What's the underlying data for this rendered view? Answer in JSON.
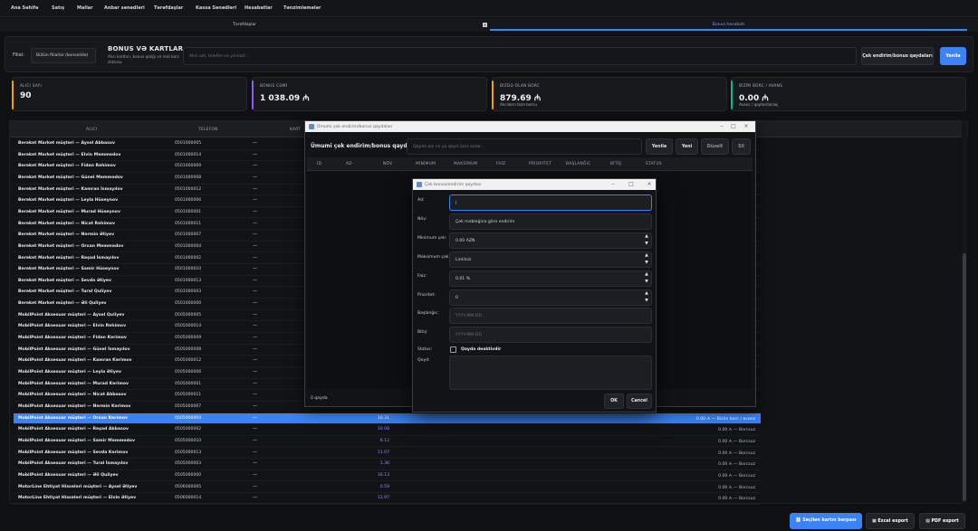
{
  "menu": [
    "Ana Səhifə",
    "Satış",
    "Mallar",
    "Anbar sənədləri",
    "Tərəfdaşlar",
    "Kassa Sənədləri",
    "Hesabatlar",
    "Tənzimləmələr"
  ],
  "tabs": [
    {
      "label": "Tərəfdaşlar",
      "active": false,
      "close": "×"
    },
    {
      "label": "Bonus hesabatı",
      "active": true
    }
  ],
  "toolbar": {
    "filial_label": "Filial:",
    "filial_value": "Bütün filiallar (konsolidə)",
    "title": "BONUS VƏ KARTLAR",
    "subtitle": "Alıcı kartları, bonus qalığı və real borc statusu",
    "search_placeholder": "Alıcı adı, telefon və ya kart...",
    "rules_button": "Çek endirim/bonus qaydaları",
    "refresh_button": "Yenilə"
  },
  "cards": [
    {
      "key": "ALICI SAYI",
      "value": "90",
      "sub": "",
      "accent": "#f59e0b"
    },
    {
      "key": "BONUS CƏMİ",
      "value": "1 038.09 ₼",
      "sub": "",
      "accent": "#8b5cf6"
    },
    {
      "key": "BİZDƏ OLAN BORC",
      "value": "879.69 ₼",
      "sub": "Alıcıların bizə borcu",
      "accent": "#f59e0b"
    },
    {
      "key": "BİZİM BORC / AVANS",
      "value": "0.00 ₼",
      "sub": "Avans / qaytarılacaq",
      "accent": "#10b981"
    }
  ],
  "grid_headers": {
    "alici": "ALICI",
    "telefon": "TELEFON",
    "kart": "KART"
  },
  "rows": [
    {
      "name": "Bərəkət Market müştəri — Aysel Abbasov",
      "phone": "0501000005",
      "card": "—",
      "bonus": "",
      "status": ""
    },
    {
      "name": "Bərəkət Market müştəri — Elvin Məmmədov",
      "phone": "0501000014",
      "card": "—",
      "bonus": "",
      "status": ""
    },
    {
      "name": "Bərəkət Market müştəri — Fidan Rəhimov",
      "phone": "0501000009",
      "card": "—",
      "bonus": "",
      "status": ""
    },
    {
      "name": "Bərəkət Market müştəri — Günel Məmmədov",
      "phone": "0501000008",
      "card": "—",
      "bonus": "",
      "status": ""
    },
    {
      "name": "Bərəkət Market müştəri — Kamran İsmayılov",
      "phone": "0501000012",
      "card": "—",
      "bonus": "",
      "status": ""
    },
    {
      "name": "Bərəkət Market müştəri — Leyla Hüseynov",
      "phone": "0501000006",
      "card": "—",
      "bonus": "",
      "status": ""
    },
    {
      "name": "Bərəkət Market müştəri — Murad Hüseynov",
      "phone": "0501000001",
      "card": "—",
      "bonus": "",
      "status": ""
    },
    {
      "name": "Bərəkət Market müştəri — Nicat Rəhimov",
      "phone": "0501000011",
      "card": "—",
      "bonus": "",
      "status": ""
    },
    {
      "name": "Bərəkət Market müştəri — Nərmin Əliyev",
      "phone": "0501000007",
      "card": "—",
      "bonus": "",
      "status": ""
    },
    {
      "name": "Bərəkət Market müştəri — Orxan Məmmədov",
      "phone": "0501000004",
      "card": "—",
      "bonus": "",
      "status": ""
    },
    {
      "name": "Bərəkət Market müştəri — Rəşad İsmayılov",
      "phone": "0501000002",
      "card": "—",
      "bonus": "",
      "status": ""
    },
    {
      "name": "Bərəkət Market müştəri — Samir Hüseynov",
      "phone": "0501000010",
      "card": "—",
      "bonus": "",
      "status": ""
    },
    {
      "name": "Bərəkət Market müştəri — Sevda Əliyev",
      "phone": "0501000013",
      "card": "—",
      "bonus": "",
      "status": ""
    },
    {
      "name": "Bərəkət Market müştəri — Tural Quliyev",
      "phone": "0501000003",
      "card": "—",
      "bonus": "",
      "status": ""
    },
    {
      "name": "Bərəkət Market müştəri — Əli Quliyev",
      "phone": "0501000000",
      "card": "—",
      "bonus": "",
      "status": ""
    },
    {
      "name": "MobilPoint Aksesuar müştəri — Aysel Quliyev",
      "phone": "0505000005",
      "card": "—",
      "bonus": "",
      "status": ""
    },
    {
      "name": "MobilPoint Aksesuar müştəri — Elvin Rəhimov",
      "phone": "0505000014",
      "card": "—",
      "bonus": "",
      "status": ""
    },
    {
      "name": "MobilPoint Aksesuar müştəri — Fidan Kərimov",
      "phone": "0505000009",
      "card": "—",
      "bonus": "",
      "status": ""
    },
    {
      "name": "MobilPoint Aksesuar müştəri — Günel İsmayılov",
      "phone": "0505000008",
      "card": "—",
      "bonus": "",
      "status": ""
    },
    {
      "name": "MobilPoint Aksesuar müştəri — Kamran Kərimov",
      "phone": "0505000012",
      "card": "—",
      "bonus": "",
      "status": ""
    },
    {
      "name": "MobilPoint Aksesuar müştəri — Leyla Əliyev",
      "phone": "0505000006",
      "card": "—",
      "bonus": "",
      "status": ""
    },
    {
      "name": "MobilPoint Aksesuar müştəri — Murad Kərimov",
      "phone": "0505000001",
      "card": "—",
      "bonus": "",
      "status": ""
    },
    {
      "name": "MobilPoint Aksesuar müştəri — Nicat Abbasov",
      "phone": "0505000011",
      "card": "—",
      "bonus": "",
      "status": ""
    },
    {
      "name": "MobilPoint Aksesuar müştəri — Nərmin Kərimov",
      "phone": "0505000007",
      "card": "—",
      "bonus": "",
      "status": ""
    },
    {
      "name": "MobilPoint Aksesuar müştəri — Orxan Kərimov",
      "phone": "0505000004",
      "card": "—",
      "bonus": "10.31",
      "status": "0.00 ₼ — Bizim borc / avans",
      "selected": true
    },
    {
      "name": "MobilPoint Aksesuar müştəri — Rəşad Abbasov",
      "phone": "0505000002",
      "card": "—",
      "bonus": "10.08",
      "status": "0.00 ₼ — Borcsuz"
    },
    {
      "name": "MobilPoint Aksesuar müştəri — Samir Məmmədov",
      "phone": "0505000010",
      "card": "—",
      "bonus": "6.12",
      "status": "0.00 ₼ — Borcsuz"
    },
    {
      "name": "MobilPoint Aksesuar müştəri — Sevda Kərimov",
      "phone": "0505000013",
      "card": "—",
      "bonus": "11.07",
      "status": "0.00 ₼ — Borcsuz"
    },
    {
      "name": "MobilPoint Aksesuar müştəri — Tural İsmayılov",
      "phone": "0505000003",
      "card": "—",
      "bonus": "1.36",
      "status": "0.00 ₼ — Borcsuz"
    },
    {
      "name": "MobilPoint Aksesuar müştəri — Əli Quliyev",
      "phone": "0505000000",
      "card": "—",
      "bonus": "16.13",
      "status": "0.00 ₼ — Borcsuz"
    },
    {
      "name": "MotorLine Ehtiyat Hissələri müştəri — Aysel Əliyev",
      "phone": "0506000005",
      "card": "—",
      "bonus": "0.59",
      "status": "0.00 ₼ — Borcsuz"
    },
    {
      "name": "MotorLine Ehtiyat Hissələri müştəri — Elvin Əliyev",
      "phone": "0506000014",
      "card": "—",
      "bonus": "12.97",
      "status": "0.00 ₼ — Borcsuz"
    }
  ],
  "bottom": {
    "link_card": "Seçilən kartın bərpası",
    "excel": "Excel export",
    "pdf": "PDF export"
  },
  "win1": {
    "title": "Ümumi çek endirim/bonus qaydaları",
    "heading": "Ümumi çek endirim/bonus qaydaları:",
    "search_placeholder": "Qayda adı və ya qeyd üzrə axtar...",
    "btn_refresh": "Yenilə",
    "btn_new": "Yeni",
    "btn_edit": "Düzəlt",
    "btn_delete": "Sil",
    "cols": [
      "ID",
      "AD",
      "NÖV",
      "MİNİMUM",
      "MAKSİMUM",
      "FAİZ",
      "PRİORİTET",
      "BAŞLANĞIC",
      "BİTİŞ",
      "STATUS"
    ],
    "count": "0 qayda"
  },
  "win2": {
    "title": "Çek bonus/endirim qaydası",
    "fields": {
      "ad_label": "Ad:",
      "ad_value": "|",
      "nov_label": "Növ:",
      "nov_value": "Çek məbləğinə görə endirim",
      "min_label": "Minimum çek:",
      "min_value": "0.00 AZN",
      "max_label": "Maksimum çek:",
      "max_value": "Limitsiz",
      "faiz_label": "Faiz:",
      "faiz_value": "0.01 %",
      "prio_label": "Prioritet:",
      "prio_value": "0",
      "start_label": "Başlanğıc:",
      "start_placeholder": "YYYY-MM-DD",
      "end_label": "Bitiş:",
      "end_placeholder": "YYYY-MM-DD",
      "status_label": "Status:",
      "status_check": "Qayda deaktivdir",
      "qeyd_label": "Qeyd:"
    },
    "ok": "OK",
    "cancel": "Cancel"
  }
}
